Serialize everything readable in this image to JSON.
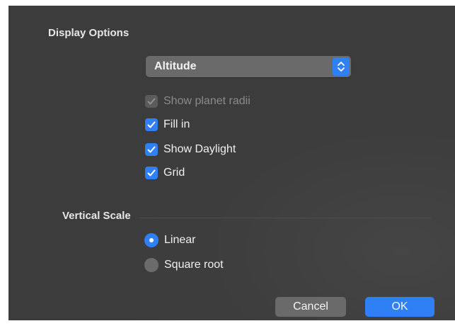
{
  "display_options": {
    "title": "Display Options",
    "mode_select": {
      "value": "Altitude",
      "icon": "up-down-chevron-icon"
    },
    "checkboxes": [
      {
        "label": "Show planet radii",
        "checked": true,
        "enabled": false
      },
      {
        "label": "Fill in",
        "checked": true,
        "enabled": true
      },
      {
        "label": "Show Daylight",
        "checked": true,
        "enabled": true
      },
      {
        "label": "Grid",
        "checked": true,
        "enabled": true
      }
    ]
  },
  "vertical_scale": {
    "title": "Vertical Scale",
    "options": [
      {
        "label": "Linear",
        "selected": true
      },
      {
        "label": "Square root",
        "selected": false
      }
    ]
  },
  "buttons": {
    "cancel": "Cancel",
    "ok": "OK"
  },
  "colors": {
    "accent": "#2f7ff5",
    "panel": "#3c3c3c",
    "control": "#6a6a6a"
  }
}
